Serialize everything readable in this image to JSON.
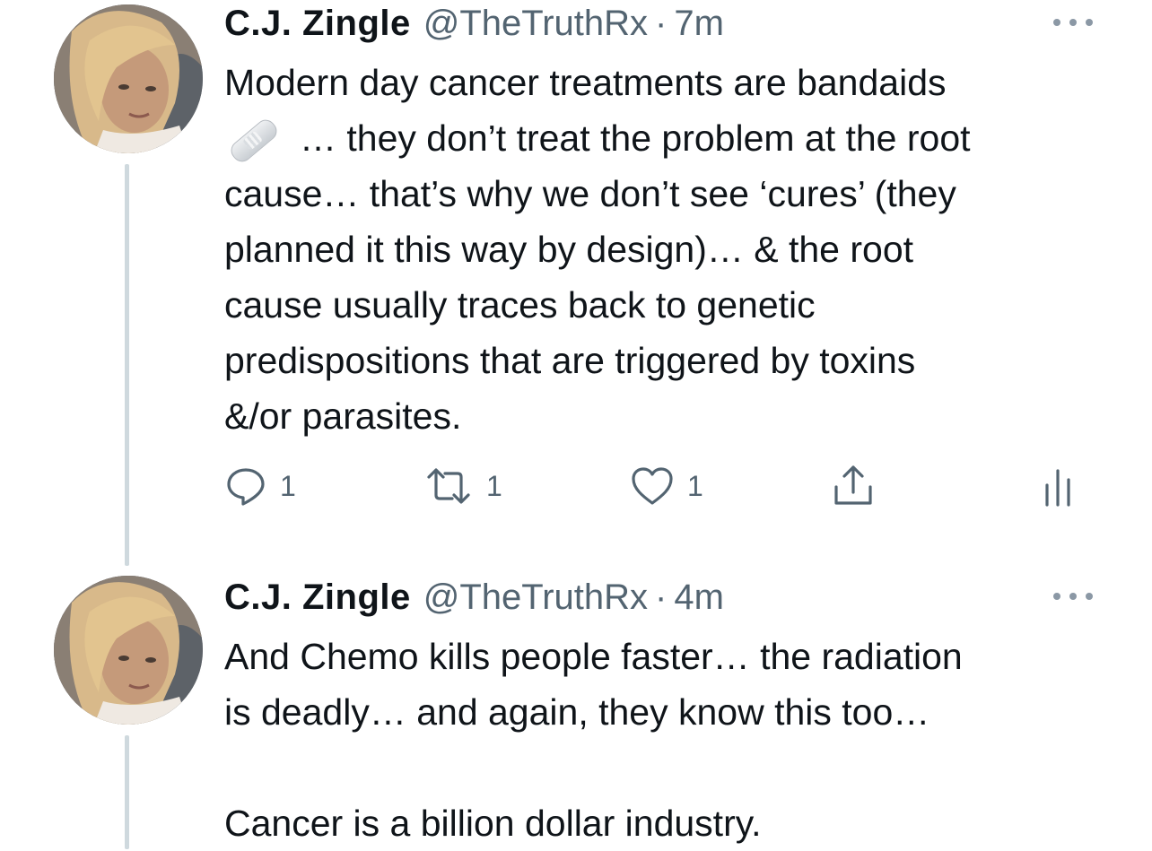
{
  "tweets": [
    {
      "author_name": "C.J. Zingle",
      "author_handle": "@TheTruthRx",
      "separator": "·",
      "time": "7m",
      "text_lines": [
        "Modern day cancer treatments are bandaids",
        "… they don’t treat the problem at the root",
        "cause… that’s why we don’t see ‘cures’ (they",
        "planned it this way by design)… & the root",
        "cause usually traces back to genetic",
        "predispositions that are triggered by toxins",
        "&/or parasites."
      ],
      "inline_emoji": "bandage-emoji",
      "replies": "1",
      "retweets": "1",
      "likes": "1"
    },
    {
      "author_name": "C.J. Zingle",
      "author_handle": "@TheTruthRx",
      "separator": "·",
      "time": "4m",
      "text_lines": [
        "And Chemo kills people faster… the radiation",
        "is deadly… and again, they know this too…",
        "",
        "Cancer is a billion dollar industry."
      ]
    }
  ],
  "icons": {
    "more": "more-dots-icon",
    "reply": "reply-icon",
    "retweet": "retweet-icon",
    "like": "heart-icon",
    "share": "share-icon",
    "analytics": "analytics-icon"
  },
  "colors": {
    "text_primary": "#0f1419",
    "text_secondary": "#536471",
    "thread_line": "#cfd9de"
  }
}
